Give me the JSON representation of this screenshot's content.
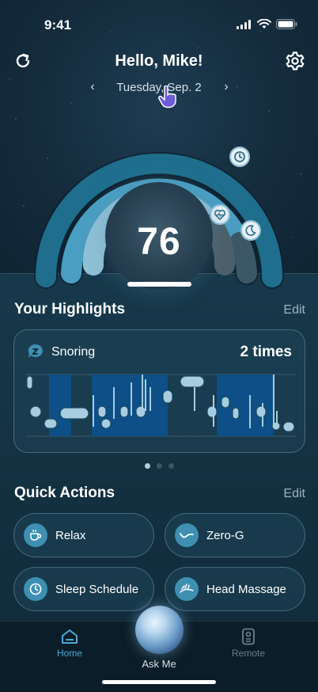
{
  "status": {
    "time": "9:41"
  },
  "header": {
    "greeting": "Hello, Mike!"
  },
  "date_nav": {
    "date": "Tuesday, Sep. 2",
    "prev": "‹",
    "next": "›"
  },
  "sleep": {
    "score": "76"
  },
  "highlights": {
    "title": "Your Highlights",
    "edit": "Edit",
    "card": {
      "label": "Snoring",
      "count": "2 times"
    },
    "pages": 3,
    "active_page": 1
  },
  "quick_actions": {
    "title": "Quick Actions",
    "edit": "Edit",
    "items": [
      {
        "label": "Relax",
        "icon": "coffee-cup-icon"
      },
      {
        "label": "Zero-G",
        "icon": "zero-g-icon"
      },
      {
        "label": "Sleep Schedule",
        "icon": "clock-moon-icon"
      },
      {
        "label": "Head Massage",
        "icon": "massage-icon"
      }
    ]
  },
  "tabbar": {
    "home": "Home",
    "ask": "Ask Me",
    "remote": "Remote"
  },
  "colors": {
    "accent": "#4aa9d6",
    "arc_outer": "#1f6e8e",
    "arc_middle": "#4a9ec2",
    "arc_inner": "#8fc0d6"
  }
}
